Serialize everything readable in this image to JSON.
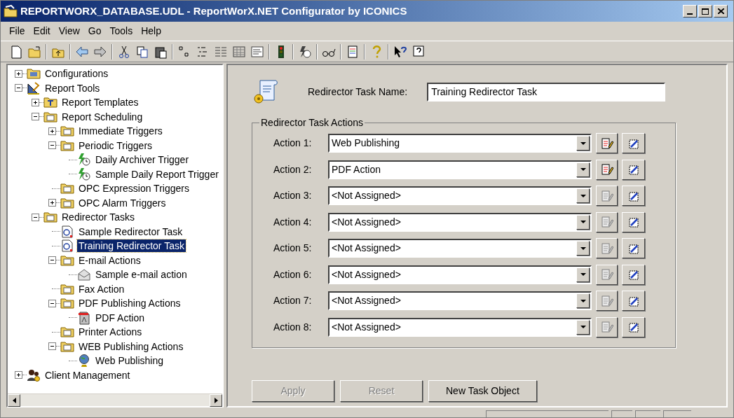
{
  "window": {
    "title": "REPORTWORX_DATABASE.UDL - ReportWorX.NET Configurator by ICONICS"
  },
  "menu": [
    "File",
    "Edit",
    "View",
    "Go",
    "Tools",
    "Help"
  ],
  "tree": [
    {
      "label": "Configurations",
      "kind": "config",
      "expanded": false,
      "selected": false
    },
    {
      "label": "Report Tools",
      "kind": "tools",
      "expanded": true,
      "selected": false,
      "children": [
        {
          "label": "Report Templates",
          "kind": "template",
          "expanded": false,
          "selected": false
        },
        {
          "label": "Report Scheduling",
          "kind": "folder",
          "expanded": true,
          "selected": false,
          "children": [
            {
              "label": "Immediate Triggers",
              "kind": "folder",
              "expanded": false,
              "selected": false
            },
            {
              "label": "Periodic Triggers",
              "kind": "folder",
              "expanded": true,
              "selected": false,
              "children": [
                {
                  "label": "Daily Archiver Trigger",
                  "kind": "trigger",
                  "selected": false
                },
                {
                  "label": "Sample Daily Report Trigger",
                  "kind": "trigger",
                  "selected": false
                }
              ]
            },
            {
              "label": "OPC Expression Triggers",
              "kind": "folder",
              "selected": false
            },
            {
              "label": "OPC Alarm Triggers",
              "kind": "folder",
              "expanded": false,
              "selected": false
            }
          ]
        },
        {
          "label": "Redirector Tasks",
          "kind": "folder",
          "expanded": true,
          "selected": false,
          "children": [
            {
              "label": "Sample Redirector Task",
              "kind": "task",
              "selected": false
            },
            {
              "label": "Training Redirector Task",
              "kind": "task",
              "selected": true
            },
            {
              "label": "E-mail Actions",
              "kind": "folder",
              "expanded": true,
              "selected": false,
              "children": [
                {
                  "label": "Sample e-mail action",
                  "kind": "email",
                  "selected": false
                }
              ]
            },
            {
              "label": "Fax Action",
              "kind": "folder",
              "selected": false
            },
            {
              "label": "PDF Publishing Actions",
              "kind": "folder",
              "expanded": true,
              "selected": false,
              "children": [
                {
                  "label": "PDF Action",
                  "kind": "pdf",
                  "selected": false
                }
              ]
            },
            {
              "label": "Printer Actions",
              "kind": "folder",
              "selected": false
            },
            {
              "label": "WEB Publishing Actions",
              "kind": "folder",
              "expanded": true,
              "selected": false,
              "children": [
                {
                  "label": "Web Publishing",
                  "kind": "globe",
                  "selected": false
                }
              ]
            }
          ]
        }
      ]
    },
    {
      "label": "Client Management",
      "kind": "people",
      "expanded": false,
      "selected": false
    }
  ],
  "task_name": {
    "label": "Redirector Task Name:",
    "value": "Training Redirector Task"
  },
  "actions_group": {
    "title": "Redirector Task Actions",
    "actions": [
      {
        "label": "Action 1:",
        "value": "Web Publishing",
        "edit_enabled": true
      },
      {
        "label": "Action 2:",
        "value": "PDF Action",
        "edit_enabled": true
      },
      {
        "label": "Action 3:",
        "value": "<Not Assigned>",
        "edit_enabled": false
      },
      {
        "label": "Action 4:",
        "value": "<Not Assigned>",
        "edit_enabled": false
      },
      {
        "label": "Action 5:",
        "value": "<Not Assigned>",
        "edit_enabled": false
      },
      {
        "label": "Action 6:",
        "value": "<Not Assigned>",
        "edit_enabled": false
      },
      {
        "label": "Action 7:",
        "value": "<Not Assigned>",
        "edit_enabled": false
      },
      {
        "label": "Action 8:",
        "value": "<Not Assigned>",
        "edit_enabled": false
      }
    ]
  },
  "buttons": [
    {
      "label": "Apply",
      "disabled": true
    },
    {
      "label": "Reset",
      "disabled": true
    },
    {
      "label": "New Task Object",
      "disabled": false
    }
  ]
}
